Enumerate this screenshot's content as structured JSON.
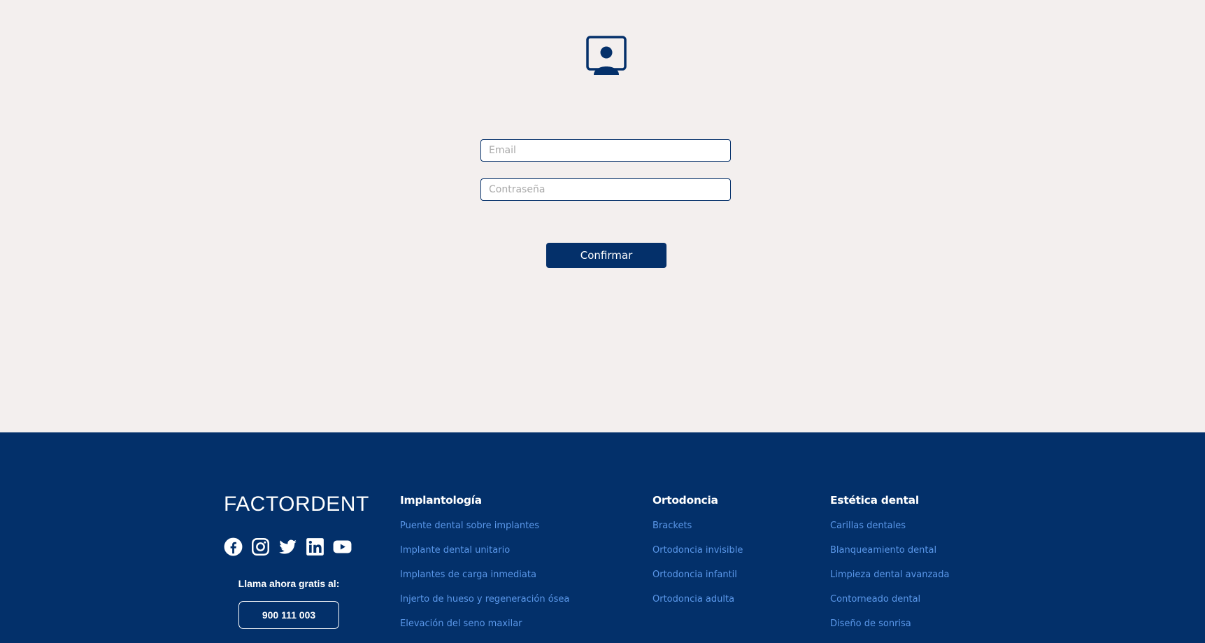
{
  "login": {
    "icon": "user-screen-icon",
    "email_placeholder": "Email",
    "password_placeholder": "Contraseña",
    "confirm_label": "Confirmar"
  },
  "footer": {
    "brand": "FACTORDENT",
    "socials": [
      {
        "icon": "facebook-icon"
      },
      {
        "icon": "instagram-icon"
      },
      {
        "icon": "twitter-icon"
      },
      {
        "icon": "linkedin-icon"
      },
      {
        "icon": "youtube-icon"
      }
    ],
    "call_label": "Llama ahora gratis al:",
    "phone": "900 111 003",
    "columns": [
      {
        "title": "Implantología",
        "links": [
          "Puente dental sobre implantes",
          "Implante dental unitario",
          "Implantes de carga inmediata",
          "Injerto de hueso y regeneración ósea",
          "Elevación del seno maxilar"
        ]
      },
      {
        "title": "Ortodoncia",
        "links": [
          "Brackets",
          "Ortodoncia invisible",
          "Ortodoncia infantil",
          "Ortodoncia adulta"
        ]
      },
      {
        "title": "Estética dental",
        "links": [
          "Carillas dentales",
          "Blanqueamiento dental",
          "Limpieza dental avanzada",
          "Contorneado dental",
          "Diseño de sonrisa"
        ]
      }
    ]
  },
  "colors": {
    "background": "#f3efee",
    "primary": "#04306a",
    "footer_link": "#5b98ea"
  }
}
